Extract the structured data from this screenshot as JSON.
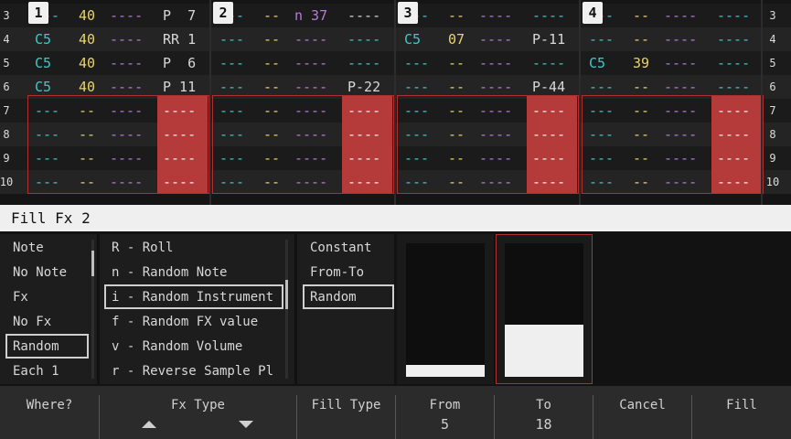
{
  "row_numbers": [
    "3",
    "4",
    "5",
    "6",
    "7",
    "8",
    "9",
    "10"
  ],
  "tracks": [
    {
      "label": "1"
    },
    {
      "label": "2"
    },
    {
      "label": "3"
    },
    {
      "label": "4"
    }
  ],
  "cells": [
    {
      "t": 0,
      "r": 0,
      "c": "inst",
      "text": "40"
    },
    {
      "t": 0,
      "r": 0,
      "c": "fxd",
      "text": "----"
    },
    {
      "t": 0,
      "r": 0,
      "c": "val",
      "text": "P  7"
    },
    {
      "t": 0,
      "r": 1,
      "c": "note",
      "text": "C5"
    },
    {
      "t": 0,
      "r": 1,
      "c": "inst",
      "text": "40"
    },
    {
      "t": 0,
      "r": 1,
      "c": "fxd",
      "text": "----"
    },
    {
      "t": 0,
      "r": 1,
      "c": "val",
      "text": "RR 1"
    },
    {
      "t": 0,
      "r": 2,
      "c": "note",
      "text": "C5"
    },
    {
      "t": 0,
      "r": 2,
      "c": "inst",
      "text": "40"
    },
    {
      "t": 0,
      "r": 2,
      "c": "fxd",
      "text": "----"
    },
    {
      "t": 0,
      "r": 2,
      "c": "val",
      "text": "P  6"
    },
    {
      "t": 0,
      "r": 3,
      "c": "note",
      "text": "C5"
    },
    {
      "t": 0,
      "r": 3,
      "c": "inst",
      "text": "40"
    },
    {
      "t": 0,
      "r": 3,
      "c": "fxd",
      "text": "----"
    },
    {
      "t": 0,
      "r": 3,
      "c": "val",
      "text": "P 11"
    },
    {
      "t": 1,
      "r": 0,
      "c": "inst",
      "text": "--"
    },
    {
      "t": 1,
      "r": 0,
      "c": "fxd",
      "text": "n 37"
    },
    {
      "t": 1,
      "r": 0,
      "c": "val",
      "text": "----"
    },
    {
      "t": 1,
      "r": 3,
      "c": "val",
      "text": "P-22"
    },
    {
      "t": 2,
      "r": 1,
      "c": "note",
      "text": "C5"
    },
    {
      "t": 2,
      "r": 1,
      "c": "inst",
      "text": "07"
    },
    {
      "t": 2,
      "r": 1,
      "c": "val",
      "text": "P-11"
    },
    {
      "t": 2,
      "r": 3,
      "c": "val",
      "text": "P-44"
    },
    {
      "t": 3,
      "r": 2,
      "c": "note",
      "text": "C5"
    },
    {
      "t": 3,
      "r": 2,
      "c": "inst",
      "text": "39"
    }
  ],
  "empty": {
    "note": "---",
    "inst": "--",
    "fx": "----",
    "val": "----"
  },
  "title": "Fill Fx 2",
  "where_list": {
    "items": [
      "Note",
      "No Note",
      "Fx",
      "No Fx",
      "Random",
      "Each 1"
    ],
    "selected": "Random"
  },
  "fx_type_list": {
    "items": [
      "R - Roll",
      "n - Random Note",
      "i - Random Instrument",
      "f - Random FX value",
      "v - Random Volume",
      "r - Reverse Sample Pl"
    ],
    "selected": "i - Random Instrument"
  },
  "fill_type_list": {
    "items": [
      "Constant",
      "From-To",
      "Random"
    ],
    "selected": "Random"
  },
  "from_level": 0.09,
  "to_level": 0.39,
  "bottom": {
    "where": "Where?",
    "fx_type": "Fx Type",
    "fill_type": "Fill Type",
    "from_label": "From",
    "from_value": "5",
    "to_label": "To",
    "to_value": "18",
    "cancel": "Cancel",
    "fill": "Fill"
  },
  "colors": {
    "selection": "#b53a3a",
    "note": "#3ec8c8",
    "instrument": "#e8d46a",
    "fx": "#b87ad6"
  }
}
